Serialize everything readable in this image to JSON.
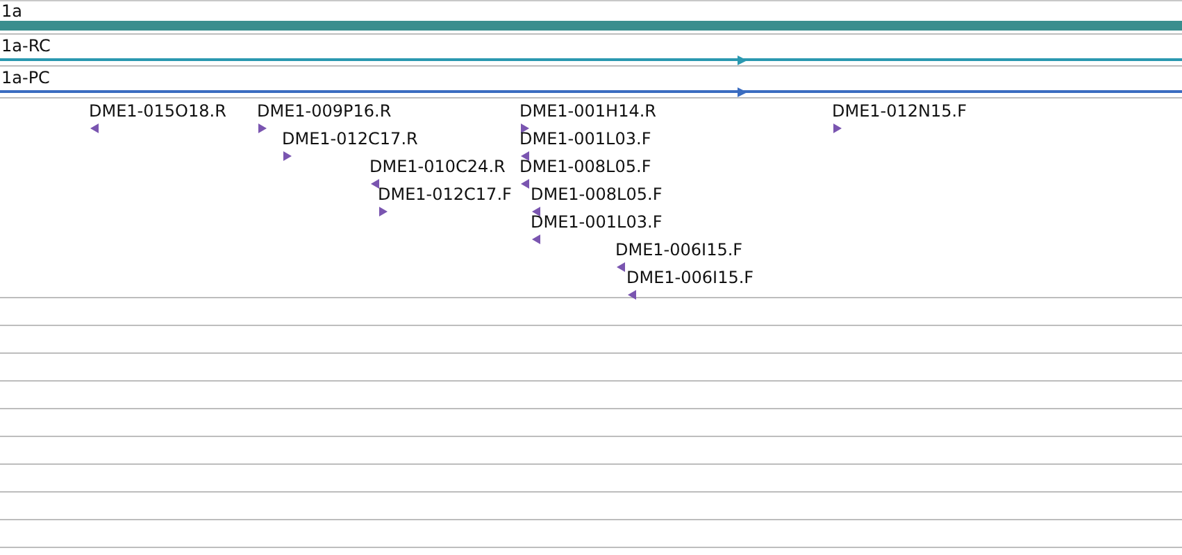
{
  "tracks": [
    {
      "label": "1a",
      "kind": "bar",
      "color": "#3a8e8e"
    },
    {
      "label": "1a-RC",
      "kind": "line",
      "color": "#2a98b0",
      "reverse": false
    },
    {
      "label": "1a-PC",
      "kind": "line",
      "color": "#3a6cc0",
      "reverse": false
    }
  ],
  "features": [
    {
      "label": "DME1-015O18.R",
      "reverse": true
    },
    {
      "label": "DME1-009P16.R",
      "reverse": false
    },
    {
      "label": "DME1-012C17.R",
      "reverse": false
    },
    {
      "label": "DME1-010C24.R",
      "reverse": true
    },
    {
      "label": "DME1-012C17.F",
      "reverse": false
    },
    {
      "label": "DME1-001H14.R",
      "reverse": false
    },
    {
      "label": "DME1-001L03.F",
      "reverse": true
    },
    {
      "label": "DME1-008L05.F",
      "reverse": true
    },
    {
      "label": "DME1-008L05.F",
      "reverse": true
    },
    {
      "label": "DME1-001L03.F",
      "reverse": true
    },
    {
      "label": "DME1-006I15.F",
      "reverse": true
    },
    {
      "label": "DME1-006I15.F",
      "reverse": true
    },
    {
      "label": "DME1-012N15.F",
      "reverse": false
    }
  ]
}
